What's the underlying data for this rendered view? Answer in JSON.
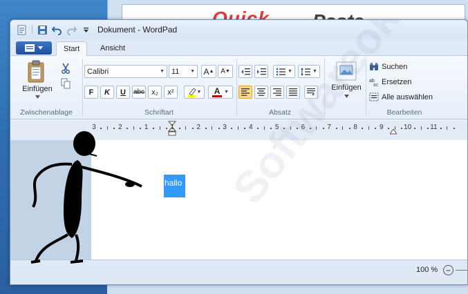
{
  "background": {
    "logo_left": "Quick",
    "logo_right": "Paste"
  },
  "window": {
    "title": "Dokument - WordPad"
  },
  "quick_access": [
    "app-icon",
    "save-icon",
    "undo-icon",
    "redo-icon",
    "customize-arrow-icon"
  ],
  "tabs": {
    "file_icon": "file-menu-icon",
    "start": "Start",
    "view": "Ansicht"
  },
  "ribbon": {
    "clipboard": {
      "paste_label": "Einfügen",
      "group_label": "Zwischenablage"
    },
    "font": {
      "font_name": "Calibri",
      "font_size": "11",
      "grow_label": "A",
      "shrink_label": "A",
      "bold": "F",
      "italic": "K",
      "underline": "U",
      "strike": "abc",
      "subscript": "x₂",
      "superscript": "x²",
      "color_label": "A",
      "group_label": "Schriftart"
    },
    "paragraph": {
      "group_label": "Absatz"
    },
    "insert": {
      "label": "Einfügen"
    },
    "editing": {
      "find": "Suchen",
      "replace": "Ersetzen",
      "select_all": "Alle auswählen",
      "group_label": "Bearbeiten"
    }
  },
  "ruler": {
    "numbers": [
      "3",
      "2",
      "1",
      "1",
      "2",
      "3",
      "4",
      "5",
      "6",
      "7",
      "8",
      "9",
      "10",
      "11"
    ]
  },
  "document": {
    "selected_text": "hallo",
    "watermark": "Softwareok.de"
  },
  "status": {
    "zoom": "100 %"
  },
  "colors": {
    "selection": "#3399ff",
    "font_color_bar": "#c00000",
    "highlight_bar": "#ffff00"
  }
}
